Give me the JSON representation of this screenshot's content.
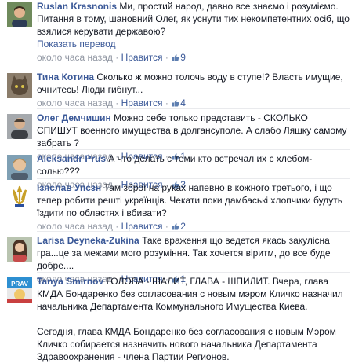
{
  "comments": [
    {
      "author": "Ruslan Krasnonis",
      "paragraphs": [
        "Ми, простий народ, давно все знаємо і розуміємо. Питання в тому, шановний Олег, як уснути тих некомпетентних осіб, що взялися керувати державою?"
      ],
      "see_translation": "Показать перевод",
      "time": "около часа назад",
      "like_label": "Нравится",
      "likes": "9"
    },
    {
      "author": "Тина Котина",
      "paragraphs": [
        "Сколько ж можно толочь воду в ступе!? Власть имущие, очнитесь! Люди гибнут..."
      ],
      "time": "около часа назад",
      "like_label": "Нравится",
      "likes": "4"
    },
    {
      "author": "Олег Демчишин",
      "paragraphs": [
        "Можно себе только представить - СКОЛЬКО СПИШУТ военного имущества в долгансуполе. А слабо Ляшку самому забрать ?"
      ],
      "time": "около часа назад",
      "like_label": "Нравится",
      "likes": "1"
    },
    {
      "author": "Aleksandr Prus",
      "paragraphs": [
        "А что делать с теми кто встречал их с хлебом-солью???"
      ],
      "time": "около часа назад",
      "like_label": "Нравится",
      "likes": "3"
    },
    {
      "author": "Ізяслав Упсзн",
      "paragraphs": [
        "Там зброї на руках напевно в кожного третього, і що тепер робити решті українців. Чекати поки дамбаські хлопчики будуть їздити по областях і вбивати?"
      ],
      "time": "около часа назад",
      "like_label": "Нравится",
      "likes": "2"
    },
    {
      "author": "Larisa Deyneka-Zukina",
      "paragraphs": [
        "Таке враження що ведется якась закулісна гра...це за межами мого розуміння. Так хочется віритм, до все буде добре...."
      ],
      "time": "около часа назад",
      "like_label": "Нравится",
      "likes": "1"
    },
    {
      "author": "Tanya Smirnov",
      "paragraphs": [
        "ГОЛОВА - ШАЛИТ, ГЛАВА - ШПИЛИТ. Вчера, глава КМДА Бондаренко без согласования с новым мэром Кличко назначил начальника Департамента Коммунального Имущества Киева.",
        "Сегодня, глава КМДА Бондаренко без согласования с новым Мэром Кличко собирается назначить нового начальника Департамента Здравоохранения - члена Партии Регионов."
      ]
    }
  ],
  "colors": {
    "link": "#3b5998",
    "text": "#141823",
    "meta": "#9197a3",
    "divider": "#e9eaed"
  },
  "icons": {
    "like": "thumbs-up-icon"
  }
}
